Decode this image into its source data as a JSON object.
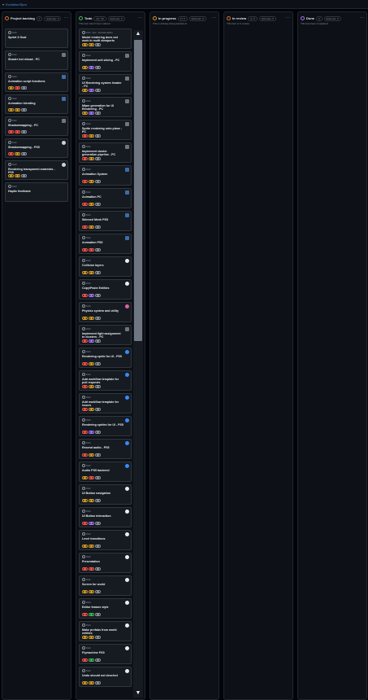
{
  "breadcrumb": {
    "prefix": "▾",
    "link": "Evolution/Spm"
  },
  "columns": [
    {
      "id": "backlog",
      "title": "Project backlog",
      "count": "7",
      "estimate": "Estimate: 0",
      "dot_color": "#db6d28",
      "description": "",
      "cards": [
        {
          "meta": "Draft",
          "title": "Sprint 3 Goal",
          "avatar": "",
          "labels": []
        },
        {
          "meta": "Draft",
          "title": "Shader hot reload - PC",
          "avatar": "platform",
          "labels": []
        },
        {
          "meta": "Draft",
          "title": "Animation script functions",
          "avatar": "gamepad",
          "labels": [
            "orange",
            "red",
            "gray"
          ]
        },
        {
          "meta": "Draft",
          "title": "Animation blending",
          "avatar": "gamepad",
          "labels": [
            "orange",
            "orange",
            "gray"
          ]
        },
        {
          "meta": "Draft",
          "title": "Shadowmapping - PC",
          "avatar": "platform",
          "labels": [
            "red",
            "red",
            "gray"
          ]
        },
        {
          "meta": "Draft",
          "title": "Shadowmapping - PS5",
          "avatar": "sony",
          "labels": [
            "red",
            "orange",
            "gray"
          ]
        },
        {
          "meta": "Draft",
          "title": "Rendering transparent materials - PS5",
          "avatar": "sony",
          "labels": [
            "orange",
            "orange",
            "gray"
          ]
        },
        {
          "meta": "Draft",
          "title": "Haptic feedback",
          "avatar": "",
          "labels": []
        }
      ]
    },
    {
      "id": "todo",
      "title": "Todo",
      "count": "20 / 30",
      "estimate": "Estimate: 0",
      "dot_color": "#3fb950",
      "description": "This item hasn't been started",
      "cards": [
        {
          "meta": "Draft · Spm · Evolution-Editor",
          "title": "Model rendering does not work in multi viewports",
          "avatar": "",
          "labels": [
            "orange",
            "orange",
            "gray"
          ]
        },
        {
          "meta": "Draft",
          "title": "Implement unit slicing - PC",
          "avatar": "platform",
          "labels": [
            "orange",
            "purple",
            "gray"
          ]
        },
        {
          "meta": "Draft",
          "title": "UI Rendering system header - PC",
          "avatar": "platform",
          "labels": [
            "orange",
            "purple",
            "gray"
          ]
        },
        {
          "meta": "Draft",
          "title": "Mipm generation for UI Rendering - PC",
          "avatar": "platform",
          "labels": [
            "orange",
            "purple",
            "gray"
          ]
        },
        {
          "meta": "Draft",
          "title": "Sprite rendering onto plane - PC",
          "avatar": "platform",
          "labels": [
            "red",
            "orange",
            "gray"
          ]
        },
        {
          "meta": "Draft",
          "title": "Implement cluster generation pipeline - PC",
          "avatar": "platform",
          "labels": [
            "red",
            "orange",
            "gray"
          ]
        },
        {
          "meta": "Draft",
          "title": "Animation System",
          "avatar": "gamepad",
          "labels": [
            "red",
            "orange",
            "gray"
          ]
        },
        {
          "meta": "Draft",
          "title": "Animation PC",
          "avatar": "gamepad",
          "labels": [
            "red",
            "orange",
            "gray"
          ]
        },
        {
          "meta": "Draft",
          "title": "Skinned Mesh PS5",
          "avatar": "gamepad",
          "labels": [
            "red",
            "orange",
            "gray"
          ]
        },
        {
          "meta": "Draft",
          "title": "Animation PS5",
          "avatar": "gamepad",
          "labels": [
            "red",
            "red",
            "gray"
          ]
        },
        {
          "meta": "Draft",
          "title": "Collision layers",
          "avatar": "white",
          "labels": [
            "orange",
            "orange",
            "gray"
          ]
        },
        {
          "meta": "Draft",
          "title": "Copy/Paste Entities",
          "avatar": "white",
          "labels": [
            "red",
            "purple",
            "gray"
          ]
        },
        {
          "meta": "Draft",
          "title": "Physics system and utility",
          "avatar": "pink",
          "labels": [
            "orange",
            "orange",
            "gray"
          ]
        },
        {
          "meta": "Draft",
          "title": "Implement light assignment to clusters - PC",
          "avatar": "platform",
          "labels": [
            "red",
            "purple",
            "gray"
          ]
        },
        {
          "meta": "Draft",
          "title": "Rendering sprite for UI - PS5",
          "avatar": "blue",
          "labels": [
            "red",
            "orange",
            "gray"
          ]
        },
        {
          "meta": "Draft",
          "title": "Add workflow template for pull requests",
          "avatar": "blue",
          "labels": [
            "red",
            "orange",
            "gray"
          ]
        },
        {
          "meta": "Draft",
          "title": "Add workflow template for issues",
          "avatar": "blue",
          "labels": [
            "red",
            "orange",
            "gray"
          ]
        },
        {
          "meta": "Draft",
          "title": "Rendering sprites for UI - PS5",
          "avatar": "blue",
          "labels": [
            "red",
            "purple",
            "gray"
          ]
        },
        {
          "meta": "Draft",
          "title": "Resend audio - PS5",
          "avatar": "blue",
          "labels": [
            "red",
            "orange",
            "gray"
          ]
        },
        {
          "meta": "Draft",
          "title": "Audio PS5 backend",
          "avatar": "blue",
          "labels": [
            "orange",
            "red",
            "gray"
          ]
        },
        {
          "meta": "Draft",
          "title": "UI Button navigation",
          "avatar": "white",
          "labels": [
            "orange",
            "orange",
            "gray"
          ]
        },
        {
          "meta": "Draft",
          "title": "UI Button interaction",
          "avatar": "white",
          "labels": [
            "red",
            "purple",
            "gray"
          ]
        },
        {
          "meta": "Draft",
          "title": "Level transitions",
          "avatar": "white",
          "labels": [
            "orange",
            "orange",
            "gray"
          ]
        },
        {
          "meta": "Draft",
          "title": "Presentation",
          "avatar": "white",
          "labels": [
            "red",
            "red",
            "gray"
          ]
        },
        {
          "meta": "Draft",
          "title": "Screen for world",
          "avatar": "white",
          "labels": [
            "orange",
            "orange",
            "gray"
          ]
        },
        {
          "meta": "Draft",
          "title": "Editor feature style",
          "avatar": "white",
          "labels": [
            "red",
            "green",
            "gray"
          ]
        },
        {
          "meta": "Draft",
          "title": "Make prefabs from world entities",
          "avatar": "white",
          "labels": [
            "orange",
            "orange",
            "gray"
          ]
        },
        {
          "meta": "Draft",
          "title": "Flymachine PS5",
          "avatar": "white",
          "labels": [
            "red",
            "green",
            "gray"
          ]
        },
        {
          "meta": "Draft",
          "title": "Undo should not deselect",
          "avatar": "white",
          "labels": [
            "orange",
            "orange",
            "gray"
          ]
        }
      ]
    },
    {
      "id": "inprogress",
      "title": "In progress",
      "count": "0 / 5",
      "estimate": "Estimate: 0",
      "dot_color": "#d29922",
      "description": "This is actively being worked on",
      "cards": []
    },
    {
      "id": "inreview",
      "title": "In review",
      "count": "0 / 5",
      "estimate": "Estimate: 0",
      "dot_color": "#db6d28",
      "description": "This item is in review",
      "cards": []
    },
    {
      "id": "done",
      "title": "Done",
      "count": "0",
      "estimate": "Estimate: 0",
      "dot_color": "#a371f7",
      "description": "This has been completed",
      "cards": []
    }
  ],
  "label_colors": {
    "orange": "#d29922",
    "red": "#f85149",
    "purple": "#a371f7",
    "green": "#3fb950",
    "gray": "#8b949e"
  },
  "scroll": {
    "up": "▲",
    "down": "▼"
  }
}
